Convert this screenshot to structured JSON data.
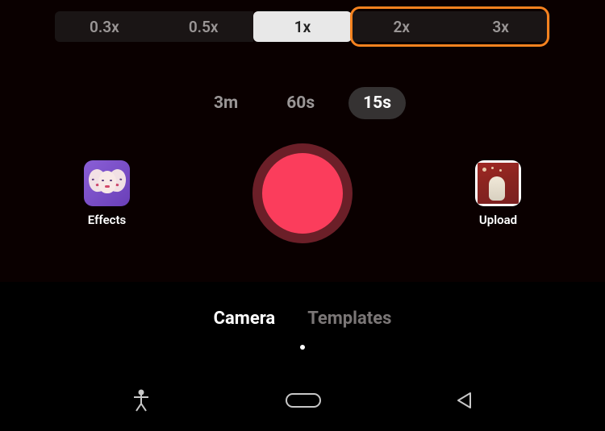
{
  "speed": {
    "options": [
      "0.3x",
      "0.5x",
      "1x",
      "2x",
      "3x"
    ],
    "selected": "1x"
  },
  "duration": {
    "options": [
      "3m",
      "60s",
      "15s"
    ],
    "selected": "15s"
  },
  "effects": {
    "label": "Effects"
  },
  "upload": {
    "label": "Upload"
  },
  "modes": {
    "camera": "Camera",
    "templates": "Templates",
    "selected": "Camera"
  },
  "icons": {
    "accessibility": "accessibility-icon",
    "home": "home-pill-icon",
    "back": "back-triangle-icon"
  }
}
